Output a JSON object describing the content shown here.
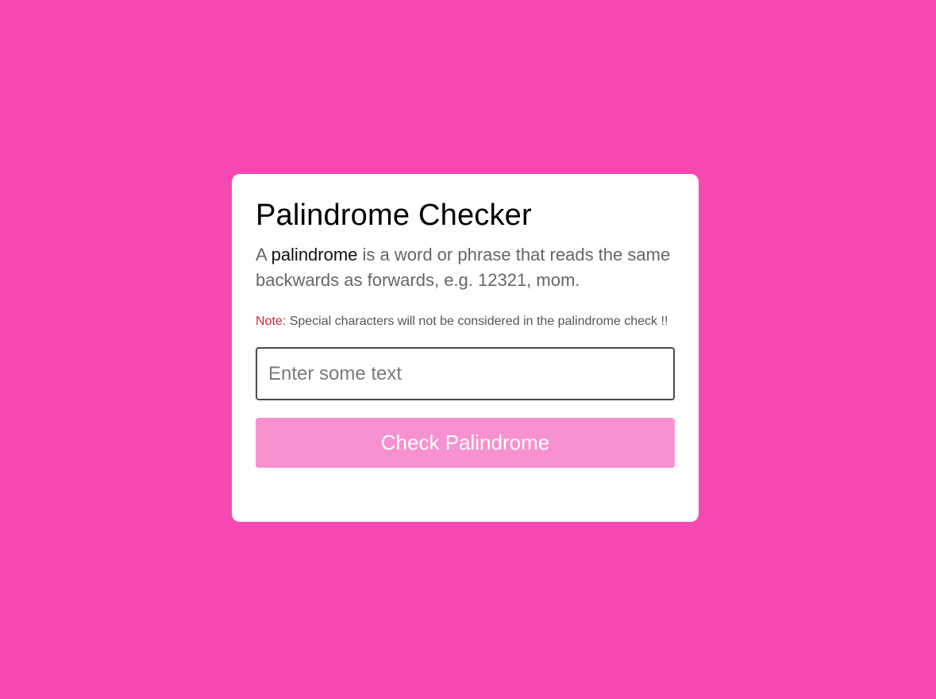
{
  "card": {
    "title": "Palindrome Checker",
    "description": {
      "prefix": "A ",
      "highlight": "palindrome",
      "suffix": " is a word or phrase that reads the same backwards as forwards, e.g. 12321, mom."
    },
    "note": {
      "label": "Note:",
      "text": " Special characters will not be considered in the palindrome check !!"
    },
    "input": {
      "value": "",
      "placeholder": "Enter some text"
    },
    "button": {
      "label": "Check Palindrome"
    }
  },
  "colors": {
    "background": "#f548b0",
    "card": "#ffffff",
    "button": "#f891cf",
    "note_label": "#d0253a"
  }
}
